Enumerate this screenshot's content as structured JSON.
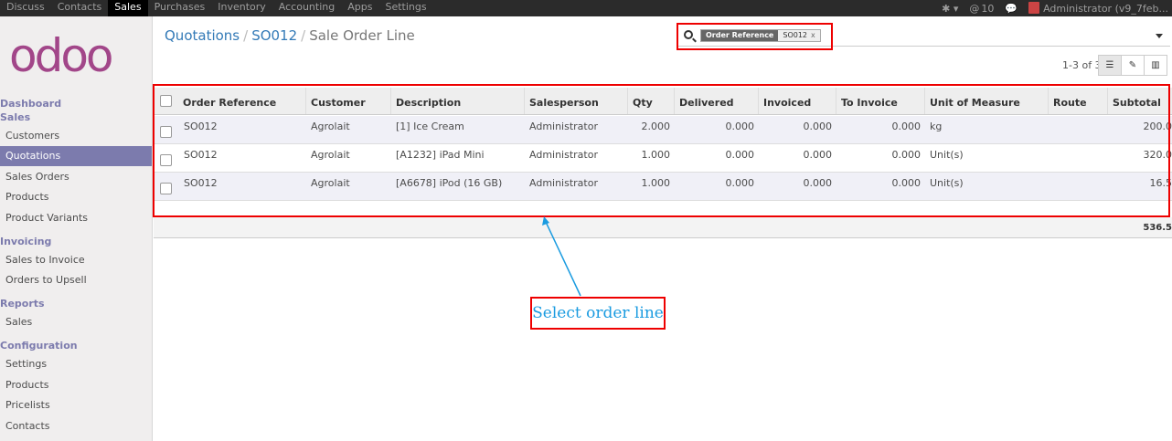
{
  "topnav": {
    "menu": [
      "Discuss",
      "Contacts",
      "Sales",
      "Purchases",
      "Inventory",
      "Accounting",
      "Apps",
      "Settings"
    ],
    "active": "Sales",
    "messages_count": "10",
    "user": "Administrator (v9_7feb..."
  },
  "sidebar": {
    "logo_text": "odoo",
    "dashboard": "Dashboard",
    "sales_section": "Sales",
    "sales_items": [
      "Customers",
      "Quotations",
      "Sales Orders",
      "Products",
      "Product Variants"
    ],
    "invoicing_section": "Invoicing",
    "invoicing_items": [
      "Sales to Invoice",
      "Orders to Upsell"
    ],
    "reports_section": "Reports",
    "reports_items": [
      "Sales"
    ],
    "config_section": "Configuration",
    "config_items": [
      "Settings",
      "Products",
      "Pricelists",
      "Contacts"
    ]
  },
  "breadcrumb": {
    "item1": "Quotations",
    "item2": "SO012",
    "current": "Sale Order Line"
  },
  "search": {
    "facet_label": "Order Reference",
    "facet_value": "SO012",
    "facet_remove": "x"
  },
  "pager": "1-3 of 3",
  "table": {
    "columns": [
      "Order Reference",
      "Customer",
      "Description",
      "Salesperson",
      "Qty",
      "Delivered",
      "Invoiced",
      "To Invoice",
      "Unit of Measure",
      "Route",
      "Subtotal"
    ],
    "rows": [
      [
        "SO012",
        "Agrolait",
        "[1] Ice Cream",
        "Administrator",
        "2.000",
        "0.000",
        "0.000",
        "0.000",
        "kg",
        "",
        "200.0"
      ],
      [
        "SO012",
        "Agrolait",
        "[A1232] iPad Mini",
        "Administrator",
        "1.000",
        "0.000",
        "0.000",
        "0.000",
        "Unit(s)",
        "",
        "320.0"
      ],
      [
        "SO012",
        "Agrolait",
        "[A6678] iPod (16 GB)",
        "Administrator",
        "1.000",
        "0.000",
        "0.000",
        "0.000",
        "Unit(s)",
        "",
        "16.5"
      ]
    ],
    "total": "536.5"
  },
  "annotation": {
    "label": "Select order line",
    "color": "#e00000",
    "text_color": "#1a9be0"
  }
}
